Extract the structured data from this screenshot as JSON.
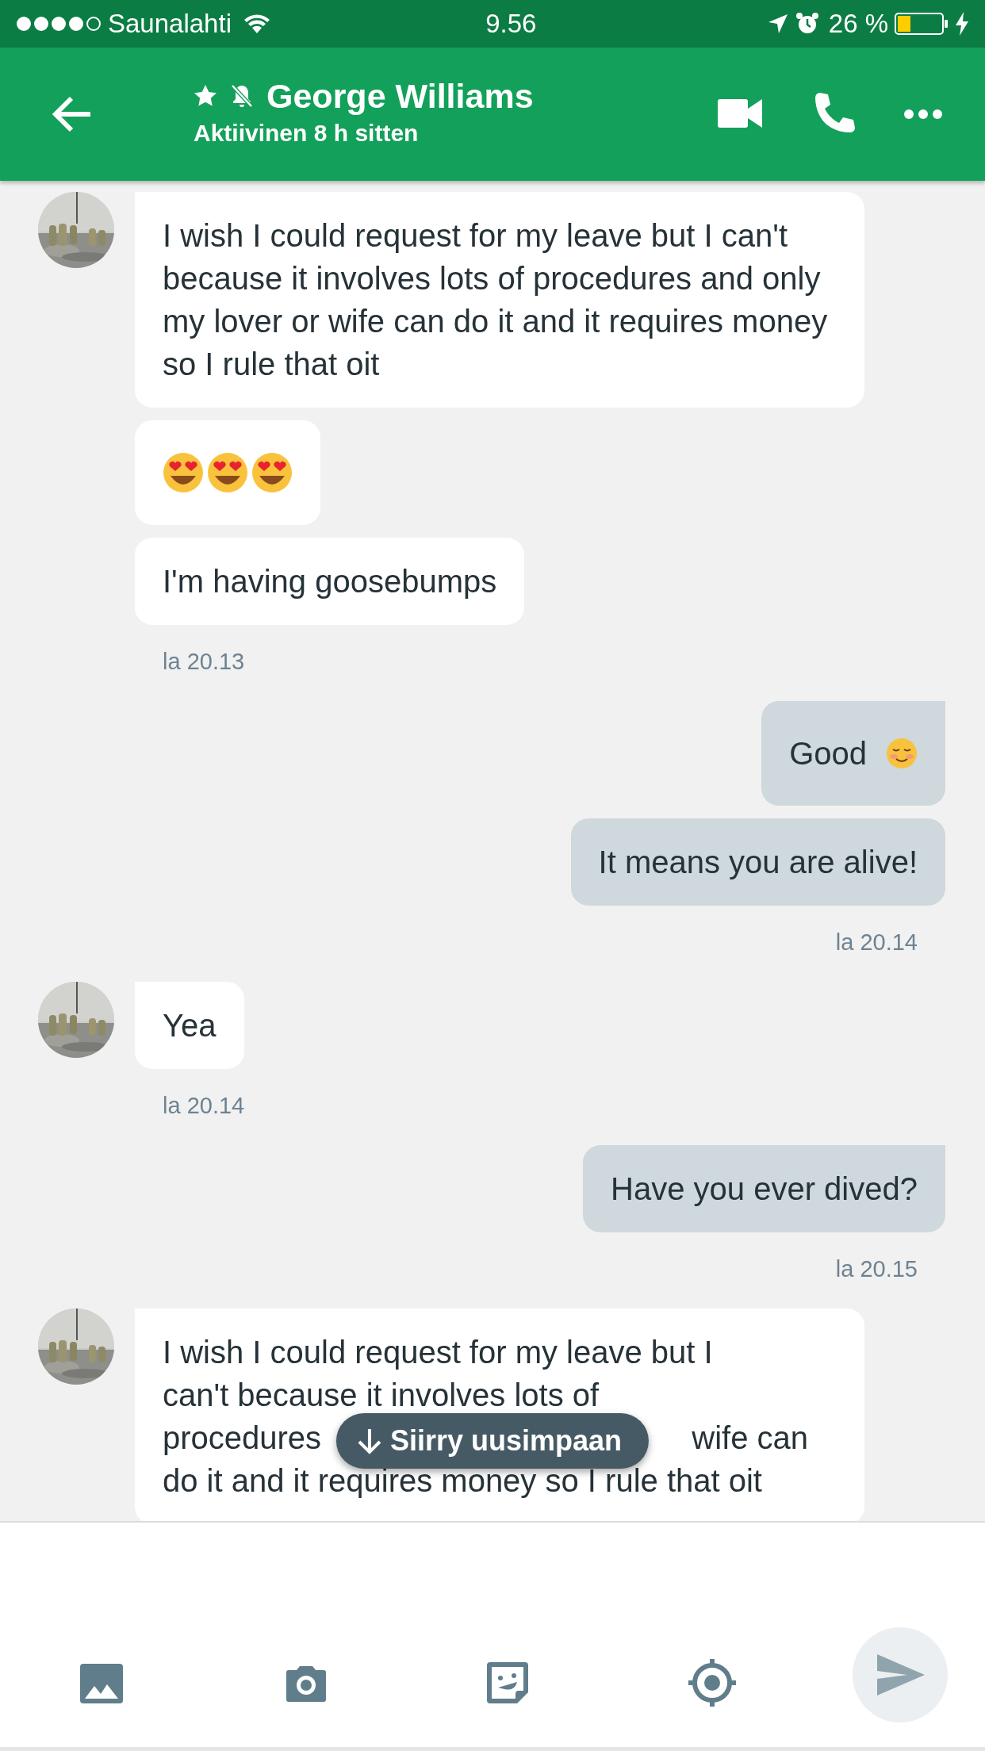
{
  "status_bar": {
    "carrier": "Saunalahti",
    "time": "9.56",
    "battery": "26 %"
  },
  "header": {
    "starred": true,
    "muted": true,
    "name": "George Williams",
    "subtitle": "Aktiivinen 8 h sitten"
  },
  "groups": [
    {
      "kind": "incoming",
      "messages": [
        {
          "kind": "text",
          "text": "I wish I could request for my leave but I can't because it involves lots of procedures and only my lover or wife can do it and it requires money so I rule that oit"
        },
        {
          "kind": "emoji",
          "emoji": [
            {
              "kind": "heart-eyes"
            },
            {
              "kind": "heart-eyes"
            },
            {
              "kind": "heart-eyes"
            }
          ]
        },
        {
          "kind": "text",
          "text": "I'm having goosebumps"
        }
      ],
      "time": "la 20.13"
    },
    {
      "kind": "outgoing",
      "messages": [
        {
          "kind": "text",
          "text": "Good",
          "emoji": [
            {
              "kind": "smiling"
            }
          ]
        },
        {
          "kind": "text",
          "text": "It means you are alive!"
        }
      ],
      "time": "la 20.14"
    },
    {
      "kind": "incoming",
      "messages": [
        {
          "kind": "text",
          "text": "Yea"
        }
      ],
      "time": "la 20.14"
    },
    {
      "kind": "outgoing",
      "messages": [
        {
          "kind": "text",
          "text": "Have you ever dived?"
        }
      ],
      "time": "la 20.15"
    },
    {
      "kind": "incoming",
      "messages": [
        {
          "kind": "lines",
          "lines": [
            [
              "I wish I could request for my leave but I"
            ],
            [
              "can't because it involves lots of"
            ],
            [
              "procedures",
              "wife can"
            ],
            [
              "do it and it requires money so I rule that oit"
            ]
          ]
        }
      ]
    }
  ],
  "jump_button": {
    "label": "Siirry uusimpaan"
  }
}
